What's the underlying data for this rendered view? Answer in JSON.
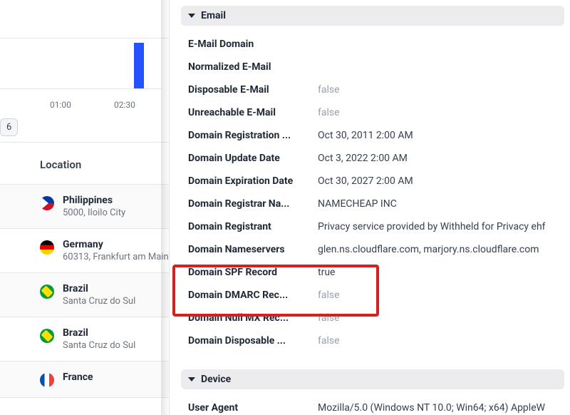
{
  "chart": {
    "ticks": [
      "01:00",
      "02:30"
    ],
    "page_pill": "6"
  },
  "left": {
    "location_header": "Location",
    "locations": [
      {
        "country": "Philippines",
        "detail": "5000, Iloilo City",
        "flag": "ph"
      },
      {
        "country": "Germany",
        "detail": "60313, Frankfurt am Main",
        "flag": "de"
      },
      {
        "country": "Brazil",
        "detail": "Santa Cruz do Sul",
        "flag": "br"
      },
      {
        "country": "Brazil",
        "detail": "Santa Cruz do Sul",
        "flag": "br"
      },
      {
        "country": "France",
        "detail": "",
        "flag": "fr"
      }
    ]
  },
  "right": {
    "email_section": "Email",
    "device_section": "Device",
    "rows": [
      {
        "label": "E-Mail Domain",
        "value": "",
        "muted": false
      },
      {
        "label": "Normalized E-Mail",
        "value": "",
        "muted": false
      },
      {
        "label": "Disposable E-Mail",
        "value": "false",
        "muted": true
      },
      {
        "label": "Unreachable E-Mail",
        "value": "false",
        "muted": true
      },
      {
        "label": "Domain Registration ...",
        "value": "Oct 30, 2011 2:00 AM",
        "muted": false
      },
      {
        "label": "Domain Update Date",
        "value": "Oct 3, 2022 2:00 AM",
        "muted": false
      },
      {
        "label": "Domain Expiration Date",
        "value": "Oct 30, 2027 2:00 AM",
        "muted": false
      },
      {
        "label": "Domain Registrar Na...",
        "value": "NAMECHEAP INC",
        "muted": false
      },
      {
        "label": "Domain Registrant",
        "value": "Privacy service provided by Withheld for Privacy ehf",
        "muted": false
      },
      {
        "label": "Domain Nameservers",
        "value": "glen.ns.cloudflare.com, marjory.ns.cloudflare.com",
        "muted": false
      },
      {
        "label": "Domain SPF Record",
        "value": "true",
        "muted": false
      },
      {
        "label": "Domain DMARC Rec...",
        "value": "false",
        "muted": true
      },
      {
        "label": "Domain Null MX Rec...",
        "value": "false",
        "muted": true
      },
      {
        "label": "Domain Disposable ...",
        "value": "false",
        "muted": true
      }
    ],
    "device_rows": [
      {
        "label": "User Agent",
        "value": "Mozilla/5.0 (Windows NT 10.0; Win64; x64) AppleW",
        "muted": false
      }
    ]
  }
}
